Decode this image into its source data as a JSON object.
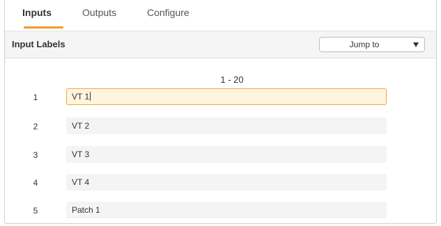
{
  "tabs": [
    {
      "label": "Inputs",
      "active": true
    },
    {
      "label": "Outputs",
      "active": false
    },
    {
      "label": "Configure",
      "active": false
    }
  ],
  "section": {
    "title": "Input Labels",
    "jump_to_label": "Jump to"
  },
  "range_label": "1 - 20",
  "labels": [
    {
      "number": "1",
      "value": "VT 1",
      "focused": true
    },
    {
      "number": "2",
      "value": "VT 2",
      "focused": false
    },
    {
      "number": "3",
      "value": "VT 3",
      "focused": false
    },
    {
      "number": "4",
      "value": "VT 4",
      "focused": false
    },
    {
      "number": "5",
      "value": "Patch 1",
      "focused": false
    }
  ],
  "colors": {
    "accent": "#f29a2e",
    "focused_field_bg": "#fff4de",
    "field_bg": "#f4f4f4",
    "header_bg": "#f5f5f5"
  }
}
